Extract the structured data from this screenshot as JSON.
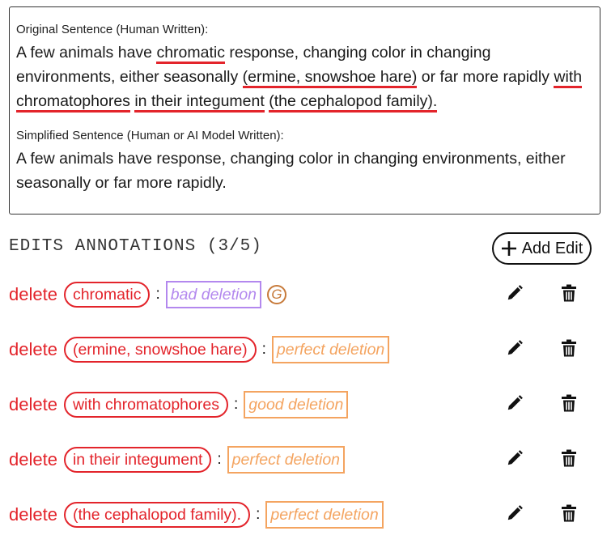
{
  "original": {
    "label": "Original Sentence (Human Written):",
    "segments": [
      {
        "text": "A few animals have ",
        "hl": false
      },
      {
        "text": "chromatic",
        "hl": true
      },
      {
        "text": " response, changing color in changing environments, either seasonally ",
        "hl": false
      },
      {
        "text": "(ermine, snowshoe hare)",
        "hl": true
      },
      {
        "text": " or far more rapidly ",
        "hl": false
      },
      {
        "text": "with chromatophores",
        "hl": true
      },
      {
        "text": " ",
        "hl": false
      },
      {
        "text": "in their integument",
        "hl": true
      },
      {
        "text": " ",
        "hl": false
      },
      {
        "text": "(the cephalopod family).",
        "hl": true
      }
    ]
  },
  "simplified": {
    "label": "Simplified Sentence (Human or AI Model Written):",
    "text": "A few animals have response, changing color in changing environments, either seasonally or far more rapidly."
  },
  "annotations": {
    "header": "EDITS ANNOTATIONS (3/5)",
    "add_label": "Add Edit"
  },
  "edits": [
    {
      "op": "delete",
      "span": "chromatic",
      "sep": ":",
      "rating": "bad deletion",
      "rating_kind": "bad",
      "badge": "G"
    },
    {
      "op": "delete",
      "span": "(ermine, snowshoe hare)",
      "sep": ":",
      "rating": "perfect deletion",
      "rating_kind": "good"
    },
    {
      "op": "delete",
      "span": "with chromatophores",
      "sep": ":",
      "rating": "good deletion",
      "rating_kind": "good"
    },
    {
      "op": "delete",
      "span": "in their integument",
      "sep": ":",
      "rating": "perfect deletion",
      "rating_kind": "good"
    },
    {
      "op": "delete",
      "span": "(the cephalopod family).",
      "sep": ":",
      "rating": "perfect deletion",
      "rating_kind": "good"
    }
  ],
  "colors": {
    "highlight": "#e3242b",
    "bad_rating": "#b388ee",
    "good_rating": "#f4a460",
    "badge": "#c77a3a"
  },
  "icons": {
    "edit": "pencil-icon",
    "delete": "trash-icon",
    "add": "plus-icon"
  }
}
